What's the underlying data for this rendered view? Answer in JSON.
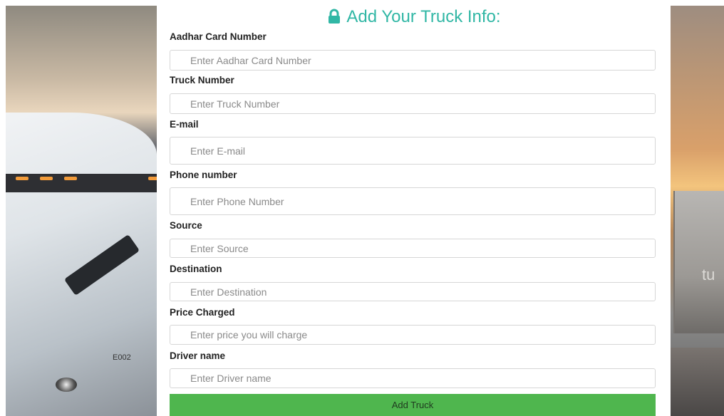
{
  "form": {
    "title": "Add Your Truck Info:",
    "accent_color": "#31b7a5",
    "title_icon": "lock-icon",
    "fields": [
      {
        "label": "Aadhar Card Number",
        "placeholder": "Enter Aadhar Card Number",
        "value": ""
      },
      {
        "label": "Truck Number",
        "placeholder": "Enter Truck Number",
        "value": ""
      },
      {
        "label": "E-mail",
        "placeholder": "Enter E-mail",
        "value": ""
      },
      {
        "label": "Phone number",
        "placeholder": "Enter Phone Number",
        "value": ""
      },
      {
        "label": "Source",
        "placeholder": "Enter Source",
        "value": ""
      },
      {
        "label": "Destination",
        "placeholder": "Enter Destination",
        "value": ""
      },
      {
        "label": "Price Charged",
        "placeholder": "Enter price you will charge",
        "value": ""
      },
      {
        "label": "Driver name",
        "placeholder": "Enter Driver name",
        "value": ""
      }
    ],
    "submit_label": "Add Truck",
    "submit_color": "#4fb64e"
  },
  "background": {
    "truck_id_text": "E002",
    "trailer_text": "tu"
  }
}
